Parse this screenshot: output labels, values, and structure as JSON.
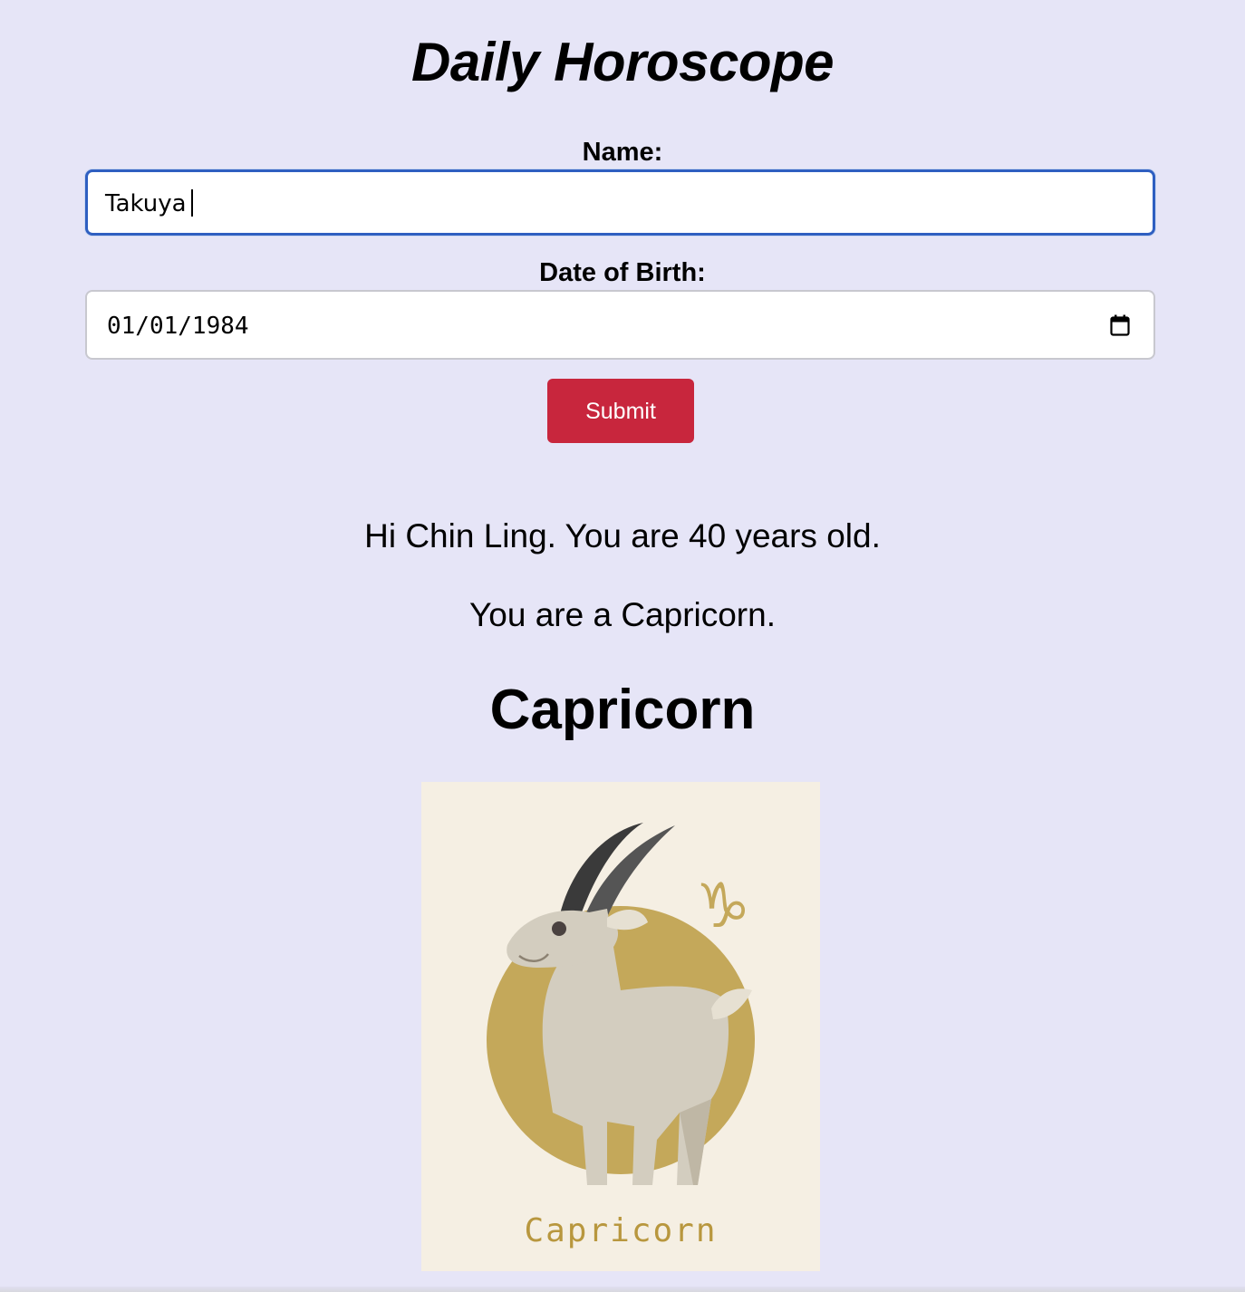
{
  "page": {
    "title": "Daily Horoscope",
    "background_color": "#e6e5f7"
  },
  "form": {
    "name_label": "Name:",
    "name_value": "Takuya",
    "dob_label": "Date of Birth:",
    "dob_value": "01/01/1984",
    "calendar_icon": "calendar-icon",
    "submit_label": "Submit",
    "submit_color": "#c8263d",
    "focus_color": "#2f5fc1"
  },
  "result": {
    "greeting": "Hi Chin Ling. You are 40 years old.",
    "sign_sentence": "You are a Capricorn.",
    "sign_heading": "Capricorn",
    "image": {
      "caption": "Capricorn",
      "symbol": "♑",
      "background_color": "#f5efe3",
      "circle_color": "#c4a85a",
      "goat_color": "#d3cdbf",
      "horn_color": "#4a4a4a"
    }
  }
}
